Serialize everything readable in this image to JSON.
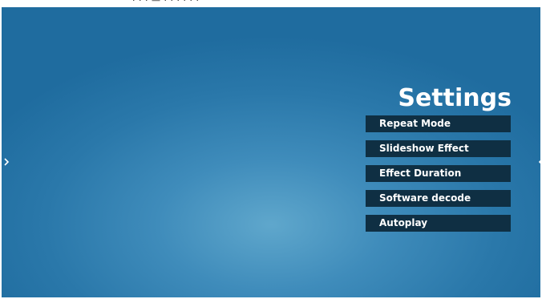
{
  "screen": {
    "title": "Settings",
    "menu": [
      {
        "label": "Repeat Mode"
      },
      {
        "label": "Slideshow Effect"
      },
      {
        "label": "Effect Duration"
      },
      {
        "label": "Software decode"
      },
      {
        "label": "Autoplay"
      }
    ]
  },
  "nav": {
    "left_icon": "chevron-right-icon",
    "right_icon": "chevron-left-icon"
  },
  "colors": {
    "background": "#2a78aa",
    "menu_item_bg": "#0f2f43",
    "text": "#ffffff"
  }
}
